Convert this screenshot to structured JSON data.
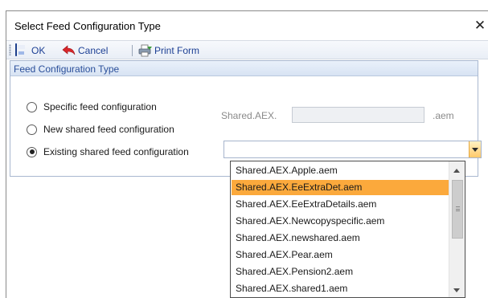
{
  "window": {
    "title": "Select Feed Configuration Type",
    "close_glyph": "✕"
  },
  "toolbar": {
    "ok_label": "OK",
    "cancel_label": "Cancel",
    "print_label": "Print Form"
  },
  "group": {
    "header": "Feed Configuration Type",
    "options": [
      {
        "label": "Specific feed configuration",
        "checked": false
      },
      {
        "label": "New shared feed configuration",
        "checked": false
      },
      {
        "label": "Existing shared feed configuration",
        "checked": true
      }
    ],
    "new_shared": {
      "prefix": "Shared.AEX.",
      "value": "",
      "suffix": ".aem"
    },
    "existing_combo": {
      "value": ""
    }
  },
  "dropdown": {
    "selected_index": 1,
    "items": [
      "Shared.AEX.Apple.aem",
      "Shared.AEX.EeExtraDet.aem",
      "Shared.AEX.EeExtraDetails.aem",
      "Shared.AEX.Newcopyspecific.aem",
      "Shared.AEX.newshared.aem",
      "Shared.AEX.Pear.aem",
      "Shared.AEX.Pension2.aem",
      "Shared.AEX.shared1.aem"
    ]
  },
  "colors": {
    "accent_selected": "#fba93c",
    "link_blue": "#1c3f94",
    "group_header": "#2a4f9a"
  },
  "icons": {
    "ok": "floppy-disk-icon",
    "cancel": "undo-arrow-icon",
    "print": "print-form-icon"
  }
}
